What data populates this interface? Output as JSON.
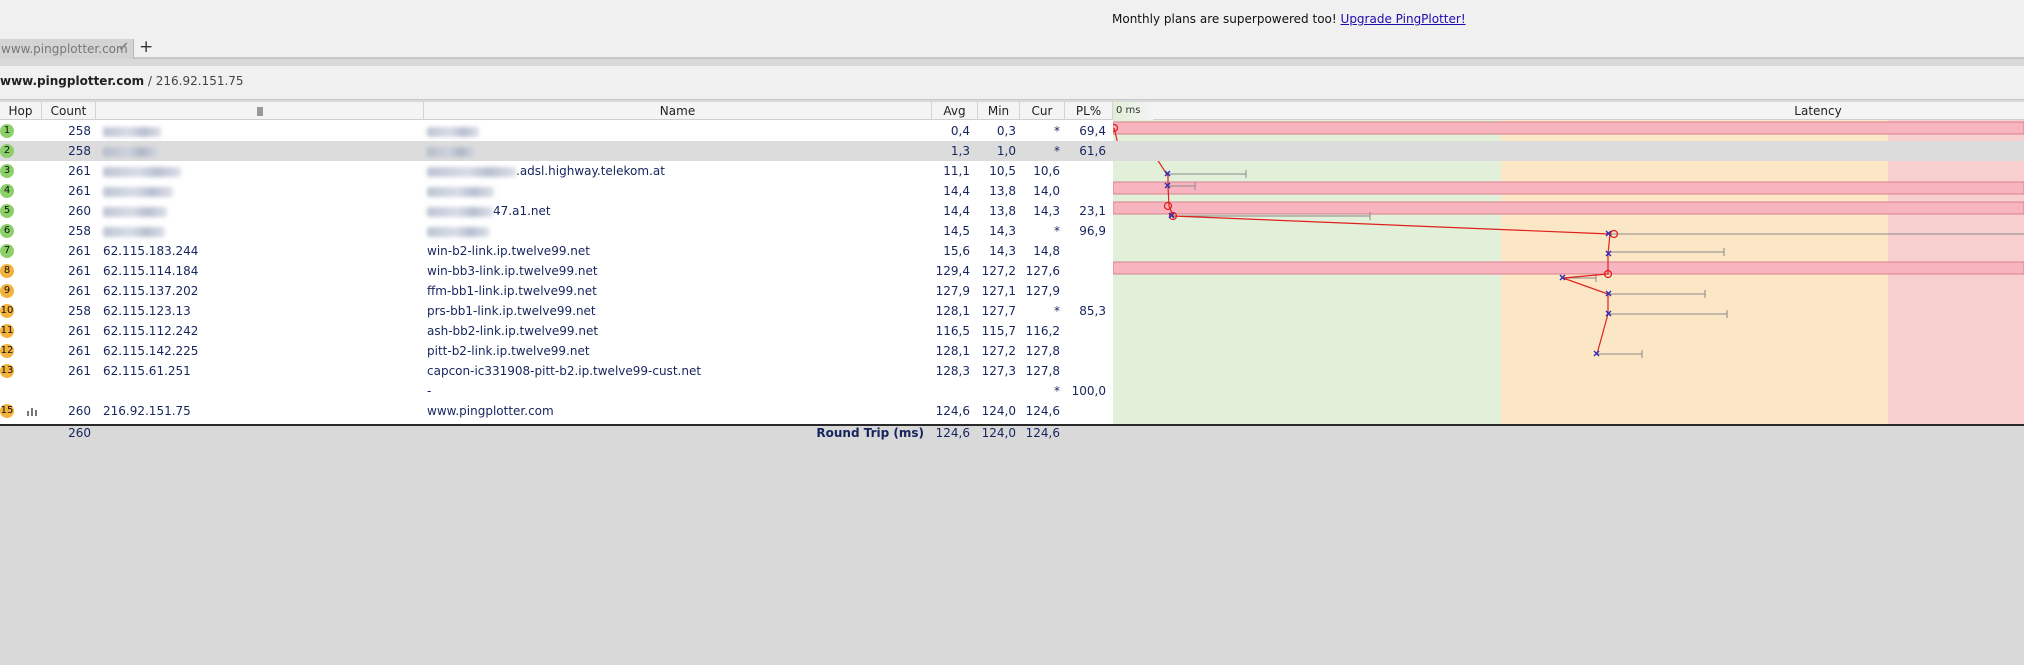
{
  "banner": {
    "text": "Monthly plans are superpowered too!",
    "link": "Upgrade PingPlotter!"
  },
  "tab": {
    "label": "www.pingplotter.com",
    "status_icon": "check-icon"
  },
  "add_tab_icon": "plus-icon",
  "address": {
    "host": "www.pingplotter.com",
    "separator": " / ",
    "ip": "216.92.151.75"
  },
  "columns": {
    "hop": "Hop",
    "count": "Count",
    "ip": "",
    "name": "Name",
    "avg": "Avg",
    "min": "Min",
    "cur": "Cur",
    "pl": "PL%",
    "latency": "Latency",
    "zero_ms": "0 ms"
  },
  "colors": {
    "good_zone": "#e2efd9",
    "warn_zone": "#fbe7c6",
    "bad_zone": "#f7cfcf",
    "loss_bar": "#f8b4bf",
    "line": "#e0201e",
    "hop_green": "#8cd06a",
    "hop_orange": "#f2b23c"
  },
  "hops": [
    {
      "hop": "1",
      "count": "258",
      "ip": "",
      "name": "",
      "avg": "0,4",
      "min": "0,3",
      "cur": "*",
      "pl": "69,4",
      "status": "green"
    },
    {
      "hop": "2",
      "count": "258",
      "ip": "",
      "name": "",
      "avg": "1,3",
      "min": "1,0",
      "cur": "*",
      "pl": "61,6",
      "status": "green"
    },
    {
      "hop": "3",
      "count": "261",
      "ip": "",
      "name": ".adsl.highway.telekom.at",
      "avg": "11,1",
      "min": "10,5",
      "cur": "10,6",
      "pl": "",
      "status": "green"
    },
    {
      "hop": "4",
      "count": "261",
      "ip": "",
      "name": "",
      "avg": "14,4",
      "min": "13,8",
      "cur": "14,0",
      "pl": "",
      "status": "green"
    },
    {
      "hop": "5",
      "count": "260",
      "ip": "",
      "name": "47.a1.net",
      "avg": "14,4",
      "min": "13,8",
      "cur": "14,3",
      "pl": "23,1",
      "status": "green"
    },
    {
      "hop": "6",
      "count": "258",
      "ip": "",
      "name": "",
      "avg": "14,5",
      "min": "14,3",
      "cur": "*",
      "pl": "96,9",
      "status": "green"
    },
    {
      "hop": "7",
      "count": "261",
      "ip": "62.115.183.244",
      "name": "win-b2-link.ip.twelve99.net",
      "avg": "15,6",
      "min": "14,3",
      "cur": "14,8",
      "pl": "",
      "status": "green"
    },
    {
      "hop": "8",
      "count": "261",
      "ip": "62.115.114.184",
      "name": "win-bb3-link.ip.twelve99.net",
      "avg": "129,4",
      "min": "127,2",
      "cur": "127,6",
      "pl": "",
      "status": "orange"
    },
    {
      "hop": "9",
      "count": "261",
      "ip": "62.115.137.202",
      "name": "ffm-bb1-link.ip.twelve99.net",
      "avg": "127,9",
      "min": "127,1",
      "cur": "127,9",
      "pl": "",
      "status": "orange"
    },
    {
      "hop": "10",
      "count": "258",
      "ip": "62.115.123.13",
      "name": "prs-bb1-link.ip.twelve99.net",
      "avg": "128,1",
      "min": "127,7",
      "cur": "*",
      "pl": "85,3",
      "status": "orange"
    },
    {
      "hop": "11",
      "count": "261",
      "ip": "62.115.112.242",
      "name": "ash-bb2-link.ip.twelve99.net",
      "avg": "116,5",
      "min": "115,7",
      "cur": "116,2",
      "pl": "",
      "status": "orange"
    },
    {
      "hop": "12",
      "count": "261",
      "ip": "62.115.142.225",
      "name": "pitt-b2-link.ip.twelve99.net",
      "avg": "128,1",
      "min": "127,2",
      "cur": "127,8",
      "pl": "",
      "status": "orange"
    },
    {
      "hop": "13",
      "count": "261",
      "ip": "62.115.61.251",
      "name": "capcon-ic331908-pitt-b2.ip.twelve99-cust.net",
      "avg": "128,3",
      "min": "127,3",
      "cur": "127,8",
      "pl": "",
      "status": "orange"
    },
    {
      "hop": "",
      "count": "",
      "ip": "",
      "name": "-",
      "avg": "",
      "min": "",
      "cur": "*",
      "pl": "100,0",
      "status": "none"
    },
    {
      "hop": "15",
      "count": "260",
      "ip": "216.92.151.75",
      "name": "www.pingplotter.com",
      "avg": "124,6",
      "min": "124,0",
      "cur": "124,6",
      "pl": "",
      "status": "orange"
    }
  ],
  "footer": {
    "count": "260",
    "label": "Round Trip (ms)",
    "avg": "124,6",
    "min": "124,0",
    "cur": "124,6"
  }
}
